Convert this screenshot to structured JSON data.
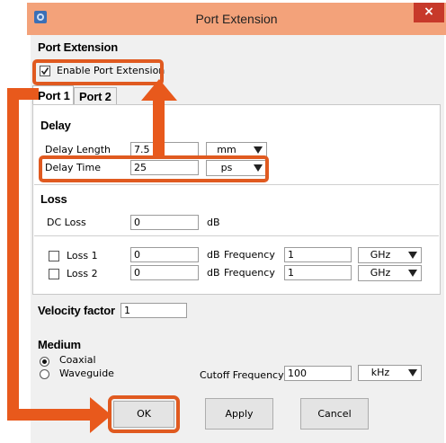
{
  "window": {
    "title": "Port Extension",
    "close_glyph": "×",
    "icon": "app-icon"
  },
  "header": {
    "section_title": "Port Extension",
    "enable_label": "Enable Port Extension",
    "enable_checked": true
  },
  "tabs": [
    {
      "label": "Port 1",
      "active": true
    },
    {
      "label": "Port 2",
      "active": false
    }
  ],
  "delay": {
    "title": "Delay",
    "length_label": "Delay Length",
    "length_value": "7.5",
    "length_unit": "mm",
    "time_label": "Delay Time",
    "time_value": "25",
    "time_unit": "ps"
  },
  "loss": {
    "title": "Loss",
    "dc_label": "DC Loss",
    "dc_value": "0",
    "dc_unit": "dB",
    "rows": [
      {
        "label": "Loss 1",
        "value": "0",
        "unit": "dB",
        "freq_label": "Frequency",
        "freq_value": "1",
        "freq_unit": "GHz",
        "checked": false
      },
      {
        "label": "Loss 2",
        "value": "0",
        "unit": "dB",
        "freq_label": "Frequency",
        "freq_value": "1",
        "freq_unit": "GHz",
        "checked": false
      }
    ]
  },
  "velocity": {
    "label": "Velocity factor",
    "value": "1"
  },
  "medium": {
    "title": "Medium",
    "options": [
      {
        "label": "Coaxial",
        "selected": true
      },
      {
        "label": "Waveguide",
        "selected": false
      }
    ],
    "cutoff_label": "Cutoff Frequency",
    "cutoff_value": "100",
    "cutoff_unit": "kHz"
  },
  "buttons": {
    "ok": "OK",
    "apply": "Apply",
    "cancel": "Cancel"
  },
  "colors": {
    "highlight": "#e05a20",
    "titlebar": "#f3a27a",
    "close": "#c7392a"
  }
}
